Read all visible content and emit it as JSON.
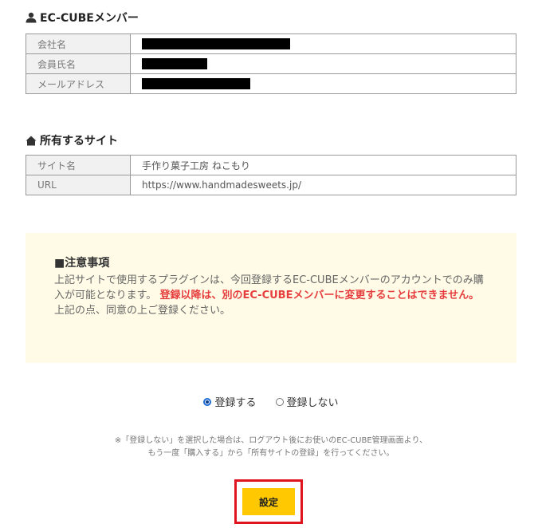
{
  "member_section": {
    "title": "EC-CUBEメンバー",
    "icon": "person-icon",
    "rows": [
      {
        "label": "会社名",
        "value_redacted": true
      },
      {
        "label": "会員氏名",
        "value_redacted": true
      },
      {
        "label": "メールアドレス",
        "value_redacted": true
      }
    ]
  },
  "site_section": {
    "title": "所有するサイト",
    "icon": "home-icon",
    "rows": [
      {
        "label": "サイト名",
        "value": "手作り菓子工房 ねこもり"
      },
      {
        "label": "URL",
        "value": "https://www.handmadesweets.jp/"
      }
    ]
  },
  "notice": {
    "title": "■注意事項",
    "line1": "上記サイトで使用するプラグインは、今回登録するEC-CUBEメンバーのアカウントでのみ購入が可能となります。",
    "warning": "登録以降は、別のEC-CUBEメンバーに変更することはできません。",
    "line2": "上記の点、同意の上ご登録ください。"
  },
  "registration": {
    "options": [
      {
        "label": "登録する",
        "checked": true
      },
      {
        "label": "登録しない",
        "checked": false
      }
    ],
    "note_line1": "※「登録しない」を選択した場合は、ログアウト後にお使いのEC-CUBE管理画面より、",
    "note_line2": "もう一度「購入する」から「所有サイトの登録」を行ってください。"
  },
  "submit": {
    "label": "設定"
  },
  "colors": {
    "accent_button": "#ffc800",
    "highlight_border": "#e0141e",
    "warning_text": "#e63e3e",
    "notice_bg": "#fffbe6"
  }
}
